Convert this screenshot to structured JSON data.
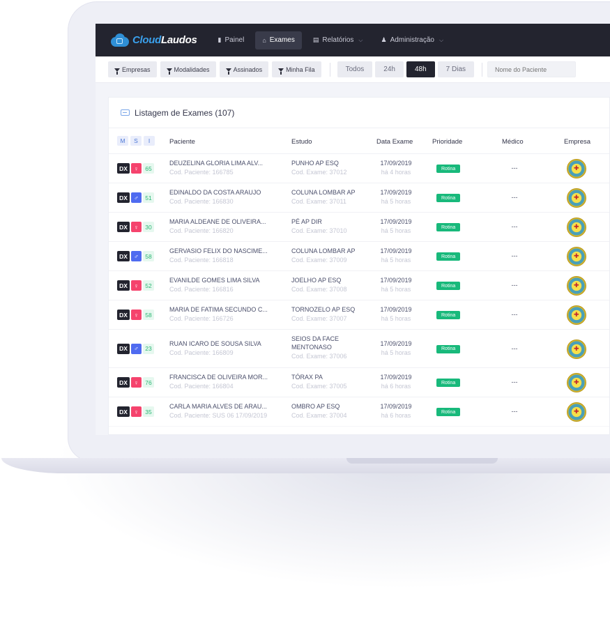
{
  "app": {
    "logo_prefix": "Cloud",
    "logo_suffix": "Laudos"
  },
  "nav": {
    "items": [
      {
        "label": "Painel",
        "icon": "bar-chart-icon"
      },
      {
        "label": "Exames",
        "icon": "inbox-icon",
        "active": true
      },
      {
        "label": "Relatórios",
        "icon": "file-icon",
        "caret": true
      },
      {
        "label": "Administração",
        "icon": "users-icon",
        "caret": true
      }
    ]
  },
  "filters": {
    "buttons": [
      "Empresas",
      "Modalidades",
      "Assinados",
      "Minha Fila"
    ],
    "time_ranges": [
      "Todos",
      "24h",
      "48h",
      "7 Dias"
    ],
    "active_time_range": "48h",
    "search_placeholder": "Nome do Paciente"
  },
  "panel": {
    "title": "Listagem de Exames (107)",
    "quick_filters": [
      "M",
      "S",
      "I"
    ],
    "columns": {
      "paciente": "Paciente",
      "estudo": "Estudo",
      "data": "Data Exame",
      "prioridade": "Prioridade",
      "medico": "Médico",
      "empresa": "Empresa"
    }
  },
  "rows": [
    {
      "modality": "DX",
      "sex": "F",
      "age": "65",
      "patient": "DEUZELINA GLORIA LIMA ALV...",
      "patient_code": "Cod. Paciente: 166785",
      "study": [
        "PUNHO AP ESQ"
      ],
      "exam_code": "Cod. Exame: 37012",
      "date": "17/09/2019",
      "ago": "há 4 horas",
      "priority": "Rotina",
      "doctor": "---"
    },
    {
      "modality": "DX",
      "sex": "M",
      "age": "51",
      "patient": "EDINALDO DA COSTA ARAUJO",
      "patient_code": "Cod. Paciente: 166830",
      "study": [
        "COLUNA LOMBAR AP"
      ],
      "exam_code": "Cod. Exame: 37011",
      "date": "17/09/2019",
      "ago": "há 5 horas",
      "priority": "Rotina",
      "doctor": "---"
    },
    {
      "modality": "DX",
      "sex": "F",
      "age": "30",
      "patient": "MARIA ALDEANE DE OLIVEIRA...",
      "patient_code": "Cod. Paciente: 166820",
      "study": [
        "PÉ AP DIR"
      ],
      "exam_code": "Cod. Exame: 37010",
      "date": "17/09/2019",
      "ago": "há 5 horas",
      "priority": "Rotina",
      "doctor": "---"
    },
    {
      "modality": "DX",
      "sex": "M",
      "age": "58",
      "patient": "GERVASIO FELIX DO NASCIME...",
      "patient_code": "Cod. Paciente: 166818",
      "study": [
        "COLUNA LOMBAR AP"
      ],
      "exam_code": "Cod. Exame: 37009",
      "date": "17/09/2019",
      "ago": "há 5 horas",
      "priority": "Rotina",
      "doctor": "---"
    },
    {
      "modality": "DX",
      "sex": "F",
      "age": "52",
      "patient": "EVANILDE GOMES LIMA SILVA",
      "patient_code": "Cod. Paciente: 166816",
      "study": [
        "JOELHO AP ESQ"
      ],
      "exam_code": "Cod. Exame: 37008",
      "date": "17/09/2019",
      "ago": "há 5 horas",
      "priority": "Rotina",
      "doctor": "---"
    },
    {
      "modality": "DX",
      "sex": "F",
      "age": "58",
      "patient": "MARIA DE FATIMA SECUNDO C...",
      "patient_code": "Cod. Paciente: 166726",
      "study": [
        "TORNOZELO AP ESQ"
      ],
      "exam_code": "Cod. Exame: 37007",
      "date": "17/09/2019",
      "ago": "há 5 horas",
      "priority": "Rotina",
      "doctor": "---"
    },
    {
      "modality": "DX",
      "sex": "M",
      "age": "23",
      "patient": "RUAN ICARO DE SOUSA SILVA",
      "patient_code": "Cod. Paciente: 166809",
      "study": [
        "SEIOS DA FACE",
        "MENTONASO"
      ],
      "exam_code": "Cod. Exame: 37006",
      "date": "17/09/2019",
      "ago": "há 5 horas",
      "priority": "Rotina",
      "doctor": "---"
    },
    {
      "modality": "DX",
      "sex": "F",
      "age": "76",
      "patient": "FRANCISCA DE OLIVEIRA MOR...",
      "patient_code": "Cod. Paciente: 166804",
      "study": [
        "TÓRAX PA"
      ],
      "exam_code": "Cod. Exame: 37005",
      "date": "17/09/2019",
      "ago": "há 6 horas",
      "priority": "Rotina",
      "doctor": "---"
    },
    {
      "modality": "DX",
      "sex": "F",
      "age": "35",
      "patient": "CARLA MARIA ALVES DE ARAU...",
      "patient_code": "Cod. Paciente: SUS 06 17/09/2019",
      "study": [
        "OMBRO AP ESQ"
      ],
      "exam_code": "Cod. Exame: 37004",
      "date": "17/09/2019",
      "ago": "há 6 horas",
      "priority": "Rotina",
      "doctor": "---"
    }
  ],
  "colors": {
    "nav_bg": "#23242f",
    "accent_blue": "#3aa0ec",
    "priority_green": "#18b97b",
    "female": "#f5436d",
    "male": "#4f6bf0"
  }
}
